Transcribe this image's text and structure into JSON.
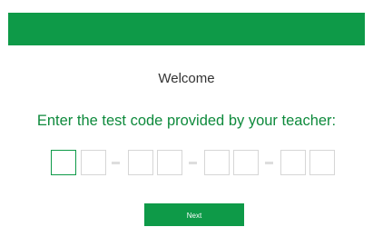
{
  "welcome": {
    "text": "Welcome"
  },
  "prompt": {
    "text": "Enter the test code provided by your teacher:"
  },
  "code": {
    "values": [
      "",
      "",
      "",
      "",
      "",
      "",
      "",
      ""
    ],
    "separator": "-"
  },
  "next_button": {
    "label": "Next"
  },
  "colors": {
    "brand_green": "#0e9a48",
    "prompt_green": "#0e8a3c"
  }
}
